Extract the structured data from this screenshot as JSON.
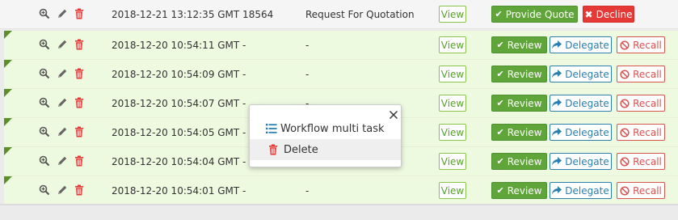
{
  "colors": {
    "row_bg": "#eefae0",
    "review_green": "#5fa53a",
    "delegate_blue": "#2a7fb0",
    "recall_red": "#d9534f",
    "decline_red": "#e53935",
    "corner_green": "#5a8f2a"
  },
  "icons": [
    "zoom-in-icon",
    "pencil-icon",
    "trash-icon"
  ],
  "first_row": {
    "date": "2018-12-21 13:12:35 GMT 18564",
    "type": "Request For Quotation",
    "view_label": "View",
    "provide_label": "Provide Quote",
    "decline_label": "Decline"
  },
  "rows": [
    {
      "date": "2018-12-20 10:54:11 GMT -",
      "type": "-"
    },
    {
      "date": "2018-12-20 10:54:09 GMT -",
      "type": "-"
    },
    {
      "date": "2018-12-20 10:54:07 GMT -",
      "type": "-"
    },
    {
      "date": "2018-12-20 10:54:05 GMT -",
      "type": "-"
    },
    {
      "date": "2018-12-20 10:54:04 GMT -",
      "type": "-"
    },
    {
      "date": "2018-12-20 10:54:01 GMT -",
      "type": "-"
    }
  ],
  "row_actions": {
    "view": "View",
    "review": "Review",
    "delegate": "Delegate",
    "recall": "Recall"
  },
  "context_menu": {
    "items": [
      {
        "label": "Workflow multi task",
        "icon": "list-icon"
      },
      {
        "label": "Delete",
        "icon": "trash-icon"
      }
    ]
  }
}
